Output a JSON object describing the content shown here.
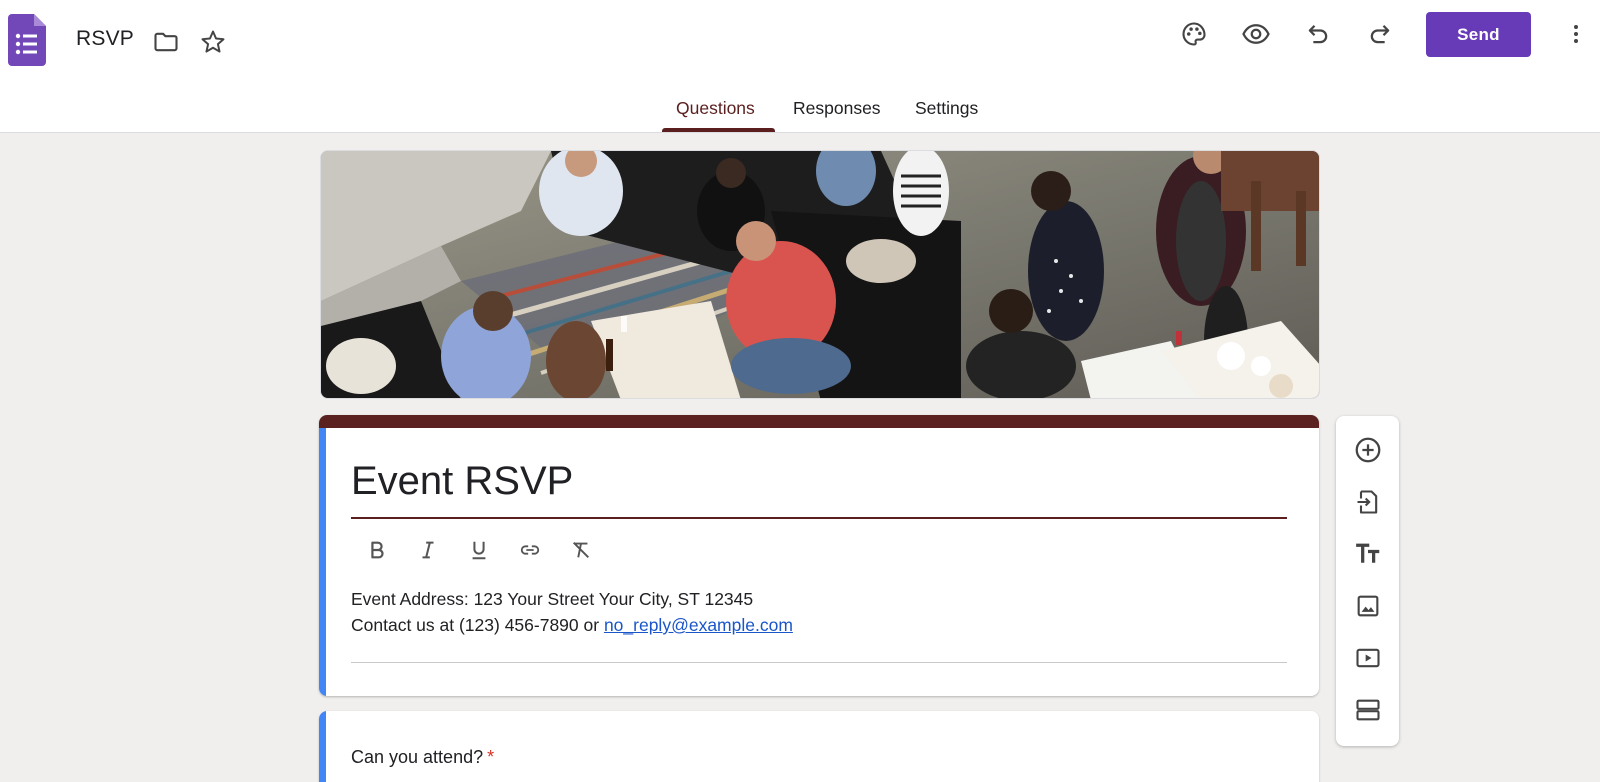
{
  "app": {
    "title": "RSVP",
    "brand_color": "#673ab7"
  },
  "toolbar": {
    "send_label": "Send"
  },
  "tabs": [
    {
      "label": "Questions",
      "active": true
    },
    {
      "label": "Responses",
      "active": false
    },
    {
      "label": "Settings",
      "active": false
    }
  ],
  "form": {
    "title": "Event RSVP",
    "description_line1": "Event Address: 123 Your Street Your City, ST 12345",
    "description_line2_prefix": "Contact us at (123) 456-7890 or ",
    "description_link": "no_reply@example.com",
    "theme_color": "#5b2121",
    "accent_color": "#4285f4"
  },
  "question": {
    "text": "Can you attend?",
    "required_mark": "*"
  },
  "icons": {
    "top": [
      "forms-app-icon",
      "folder-icon",
      "star-icon",
      "palette-icon",
      "eye-icon",
      "undo-icon",
      "redo-icon",
      "more-vert-icon"
    ],
    "format": [
      "bold-icon",
      "italic-icon",
      "underline-icon",
      "link-icon",
      "clear-format-icon"
    ],
    "side": [
      "add-question-icon",
      "import-questions-icon",
      "add-title-icon",
      "add-image-icon",
      "add-video-icon",
      "add-section-icon"
    ]
  }
}
